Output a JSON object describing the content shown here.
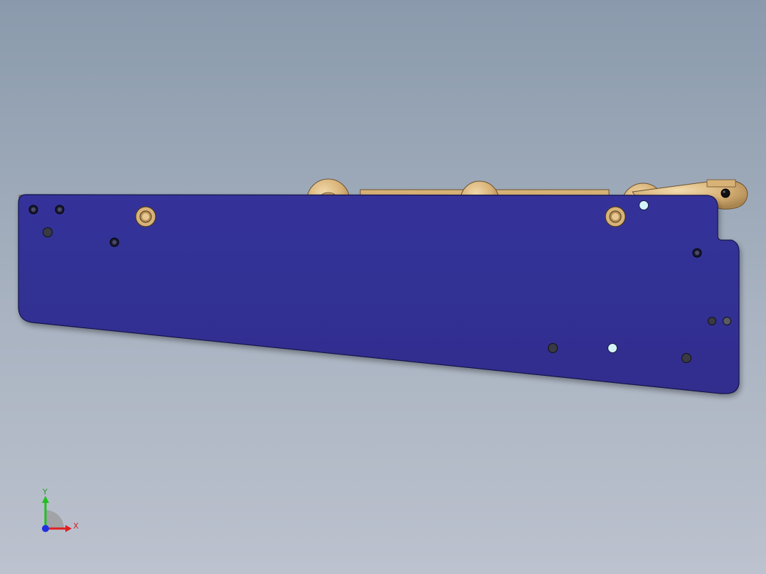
{
  "viewport": {
    "background_top": "#8a9aac",
    "background_bottom": "#bcc2ce"
  },
  "model": {
    "plate_color": "#333195",
    "plate_edge_color": "#1a1a4a",
    "bronze_color": "#d8b277",
    "bronze_edge_color": "#6a5230"
  },
  "triad": {
    "x_label": "X",
    "y_label": "Y",
    "x_color": "#e02020",
    "y_color": "#20c020",
    "z_color": "#2030e0"
  }
}
